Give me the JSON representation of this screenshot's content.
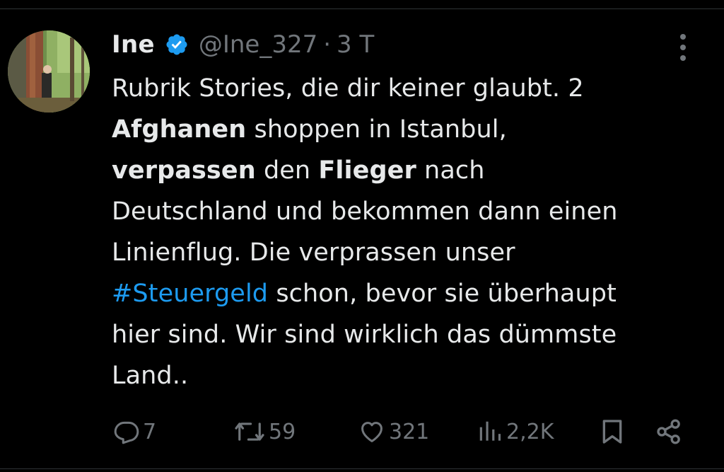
{
  "tweet": {
    "author": {
      "display_name": "Ine",
      "handle": "@Ine_327",
      "separator": "·",
      "time": "3 T",
      "verified": true,
      "avatar": "avatar-photo-forest"
    },
    "text_lines": [
      [
        {
          "t": "Rubrik Stories, die dir keiner glaubt. 2",
          "style": "normal"
        }
      ],
      [
        {
          "t": "Afghanen",
          "style": "bold"
        },
        {
          "t": " shoppen in Istanbul,",
          "style": "normal"
        }
      ],
      [
        {
          "t": "verpassen",
          "style": "bold"
        },
        {
          "t": " den ",
          "style": "normal"
        },
        {
          "t": "Flieger",
          "style": "bold"
        },
        {
          "t": " nach",
          "style": "normal"
        }
      ],
      [
        {
          "t": "Deutschland und bekommen dann einen",
          "style": "normal"
        }
      ],
      [
        {
          "t": "Linienflug. Die verprassen unser",
          "style": "normal"
        }
      ],
      [
        {
          "t": "#Steuergeld",
          "style": "hashtag"
        },
        {
          "t": " schon, bevor sie überhaupt",
          "style": "normal"
        }
      ],
      [
        {
          "t": "hier sind. Wir sind wirklich das dümmste",
          "style": "normal"
        }
      ],
      [
        {
          "t": "Land..",
          "style": "normal"
        }
      ]
    ],
    "actions": {
      "reply": {
        "icon": "reply-icon",
        "count": "7"
      },
      "retweet": {
        "icon": "retweet-icon",
        "count": "59"
      },
      "like": {
        "icon": "heart-icon",
        "count": "321"
      },
      "views": {
        "icon": "views-icon",
        "count": "2,2K"
      },
      "bookmark": {
        "icon": "bookmark-icon"
      },
      "share": {
        "icon": "share-icon"
      }
    }
  },
  "colors": {
    "background": "#000000",
    "text": "#e7e9ea",
    "muted": "#71767b",
    "accent": "#1d9bf0"
  }
}
